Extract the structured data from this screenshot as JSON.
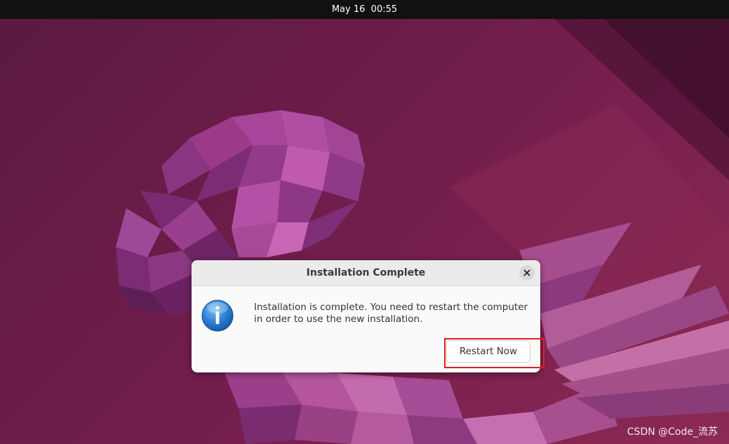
{
  "topbar": {
    "date": "May 16",
    "time": "00:55"
  },
  "dialog": {
    "title": "Installation Complete",
    "message_line1": "Installation is complete. You need to restart the computer",
    "message_line2": "in order to use the new installation.",
    "restart_label": "Restart Now",
    "close_icon": "close-icon",
    "info_icon": "info-icon"
  },
  "watermark": {
    "text": "CSDN @Code_流苏"
  },
  "colors": {
    "topbar": "#111111",
    "wallpaper_base": "#6a1c48",
    "highlight": "#e02020",
    "info_blue": "#2b7fd4"
  }
}
